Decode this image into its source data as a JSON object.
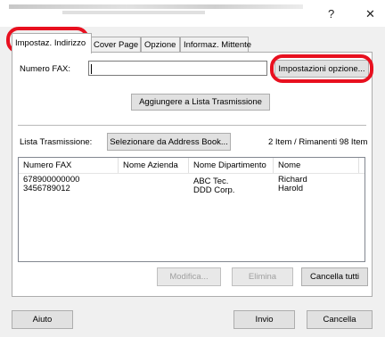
{
  "window": {
    "help_glyph": "?",
    "close_glyph": "✕"
  },
  "tabs": [
    {
      "label": "Impostaz. Indirizzo"
    },
    {
      "label": "Cover Page"
    },
    {
      "label": "Opzione"
    },
    {
      "label": "Informaz. Mittente"
    }
  ],
  "fax": {
    "label": "Numero FAX:",
    "value": "",
    "options_button": "Impostazioni opzione..."
  },
  "add_button": "Aggiungere a Lista Trasmissione",
  "transmission": {
    "label": "Lista Trasmissione:",
    "address_book_button": "Selezionare da Address Book...",
    "count": "2 Item / Rimanenti 98 Item"
  },
  "table": {
    "columns": [
      "Numero FAX",
      "Nome Azienda",
      "Nome Dipartimento",
      "Nome"
    ],
    "rows": [
      {
        "fax": "678900000000",
        "company": "",
        "department": "ABC Tec.",
        "name": "Richard"
      },
      {
        "fax": "3456789012",
        "company": "",
        "department": "DDD Corp.",
        "name": "Harold"
      }
    ]
  },
  "list_buttons": {
    "modify": "Modifica...",
    "delete": "Elimina",
    "clear_all": "Cancella tutti"
  },
  "footer": {
    "help": "Aiuto",
    "send": "Invio",
    "cancel": "Cancella"
  },
  "colors": {
    "highlight_ring": "#e8101f"
  }
}
